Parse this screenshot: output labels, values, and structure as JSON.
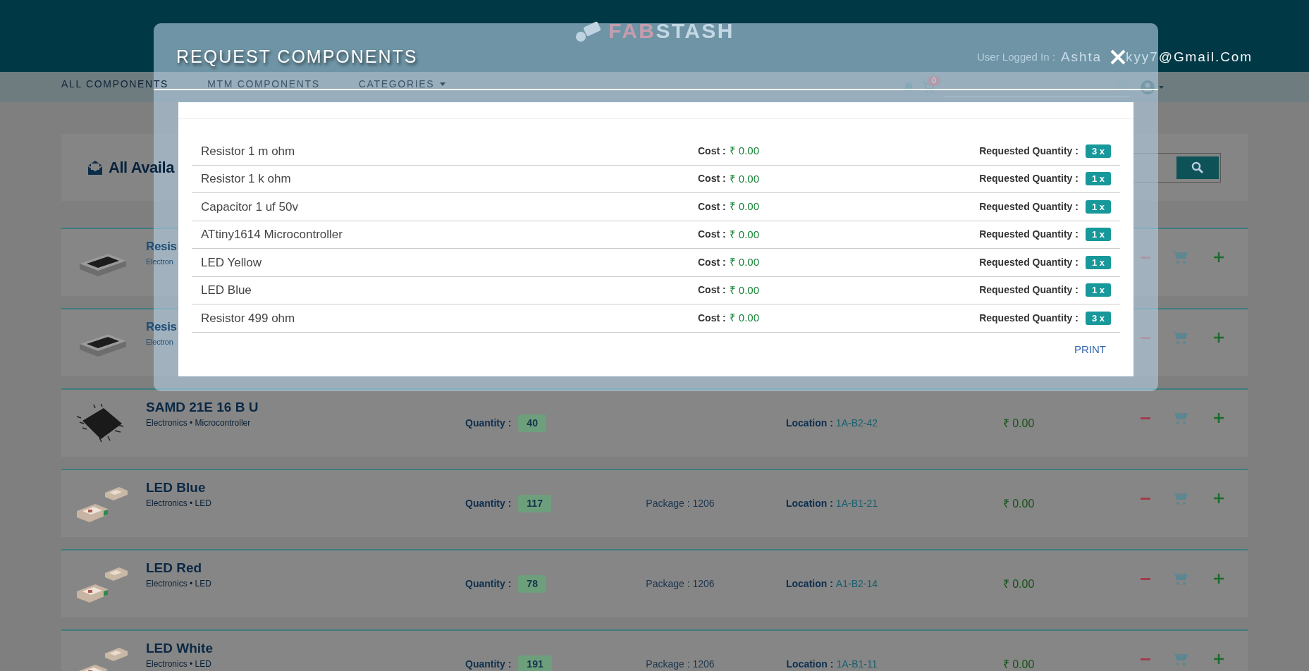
{
  "header": {
    "logo_left": "FAB",
    "logo_right": "STASH",
    "user_label": "User Logged In :",
    "user_email_start": "Ashta",
    "user_email_end": "kyy7@Gmail.Com"
  },
  "nav": {
    "items": [
      {
        "label": "ALL COMPONENTS",
        "selected": true,
        "dropdown": false
      },
      {
        "label": "MTM COMPONENTS",
        "selected": false,
        "dropdown": false
      },
      {
        "label": "CATEGORIES",
        "selected": false,
        "dropdown": true
      }
    ],
    "cart_count": "0"
  },
  "search_card": {
    "title": "All Availa"
  },
  "components": [
    {
      "kind": "resistor",
      "name": "Resis",
      "category": "Electron"
    },
    {
      "kind": "resistor",
      "name": "Resis",
      "category": "Electron"
    },
    {
      "kind": "chip",
      "name": "SAMD 21E 16 B U",
      "category": "Electronics • Microcontroller",
      "quantity_label": "Quantity :",
      "quantity": "40",
      "location_label": "Location :",
      "location": "1A-B2-42",
      "price": "₹ 0.00"
    },
    {
      "kind": "led",
      "name": "LED Blue",
      "category": "Electronics • LED",
      "quantity_label": "Quantity :",
      "quantity": "117",
      "package": "Package : 1206",
      "location_label": "Location :",
      "location": "1A-B1-21",
      "price": "₹ 0.00"
    },
    {
      "kind": "led",
      "name": "LED Red",
      "category": "Electronics • LED",
      "quantity_label": "Quantity :",
      "quantity": "78",
      "package": "Package : 1206",
      "location_label": "Location :",
      "location": "A1-B2-14",
      "price": "₹ 0.00"
    },
    {
      "kind": "led",
      "name": "LED White",
      "category": "Electronics • LED",
      "quantity_label": "Quantity :",
      "quantity": "191",
      "package": "Package : 1206",
      "location_label": "Location :",
      "location": "1A-B1-11",
      "price": "₹ 0.00"
    }
  ],
  "modal": {
    "title": "REQUEST COMPONENTS",
    "items": [
      {
        "name": "Resistor 1 m ohm",
        "cost_label": "Cost :",
        "cost": "₹ 0.00",
        "quantity_label": "Requested Quantity :",
        "quantity": "3 x"
      },
      {
        "name": "Resistor 1 k ohm",
        "cost_label": "Cost :",
        "cost": "₹ 0.00",
        "quantity_label": "Requested Quantity :",
        "quantity": "1 x"
      },
      {
        "name": "Capacitor 1 uf 50v",
        "cost_label": "Cost :",
        "cost": "₹ 0.00",
        "quantity_label": "Requested Quantity :",
        "quantity": "1 x"
      },
      {
        "name": "ATtiny1614 Microcontroller",
        "cost_label": "Cost :",
        "cost": "₹ 0.00",
        "quantity_label": "Requested Quantity :",
        "quantity": "1 x"
      },
      {
        "name": "LED Yellow",
        "cost_label": "Cost :",
        "cost": "₹ 0.00",
        "quantity_label": "Requested Quantity :",
        "quantity": "1 x"
      },
      {
        "name": "LED Blue",
        "cost_label": "Cost :",
        "cost": "₹ 0.00",
        "quantity_label": "Requested Quantity :",
        "quantity": "1 x"
      },
      {
        "name": "Resistor 499 ohm",
        "cost_label": "Cost :",
        "cost": "₹ 0.00",
        "quantity_label": "Requested Quantity :",
        "quantity": "3 x"
      }
    ],
    "print": "PRINT"
  }
}
